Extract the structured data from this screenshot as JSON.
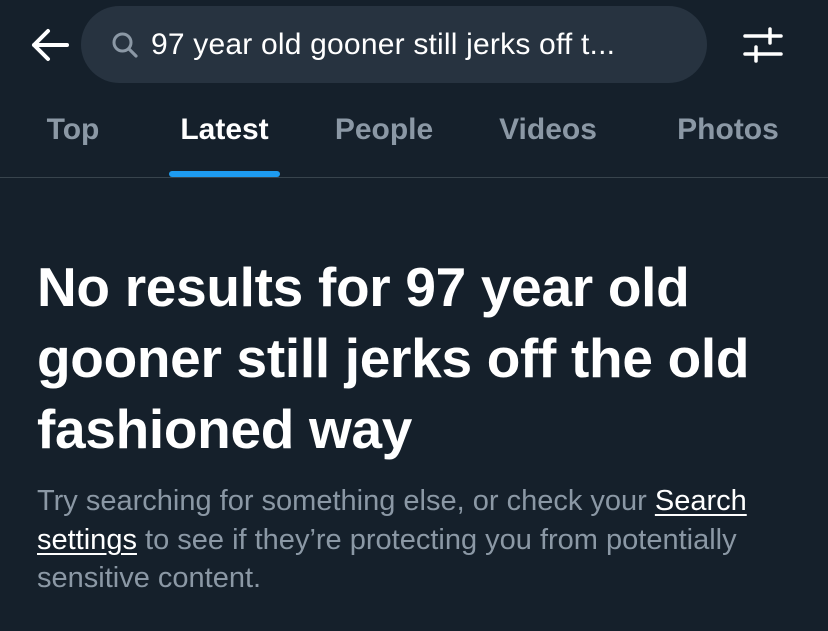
{
  "header": {
    "back_icon": "arrow-left-icon",
    "search_icon": "magnifier-icon",
    "search_query": "97 year old gooner still jerks off t...",
    "filter_icon": "sliders-icon"
  },
  "tabs": [
    {
      "label": "Top"
    },
    {
      "label": "Latest",
      "active": true
    },
    {
      "label": "People"
    },
    {
      "label": "Videos"
    },
    {
      "label": "Photos"
    }
  ],
  "results": {
    "headline": "No results for 97 year old gooner still jerks off the old fashioned way",
    "sub_before": "Try searching for something else, or check your ",
    "sub_link": "Search settings",
    "sub_after": " to see if they’re protecting you from potentially sensitive content."
  },
  "colors": {
    "background": "#15202b",
    "search_bg": "#273340",
    "accent": "#1d9bf0",
    "muted_text": "#8b98a5",
    "divider": "#38444d"
  }
}
